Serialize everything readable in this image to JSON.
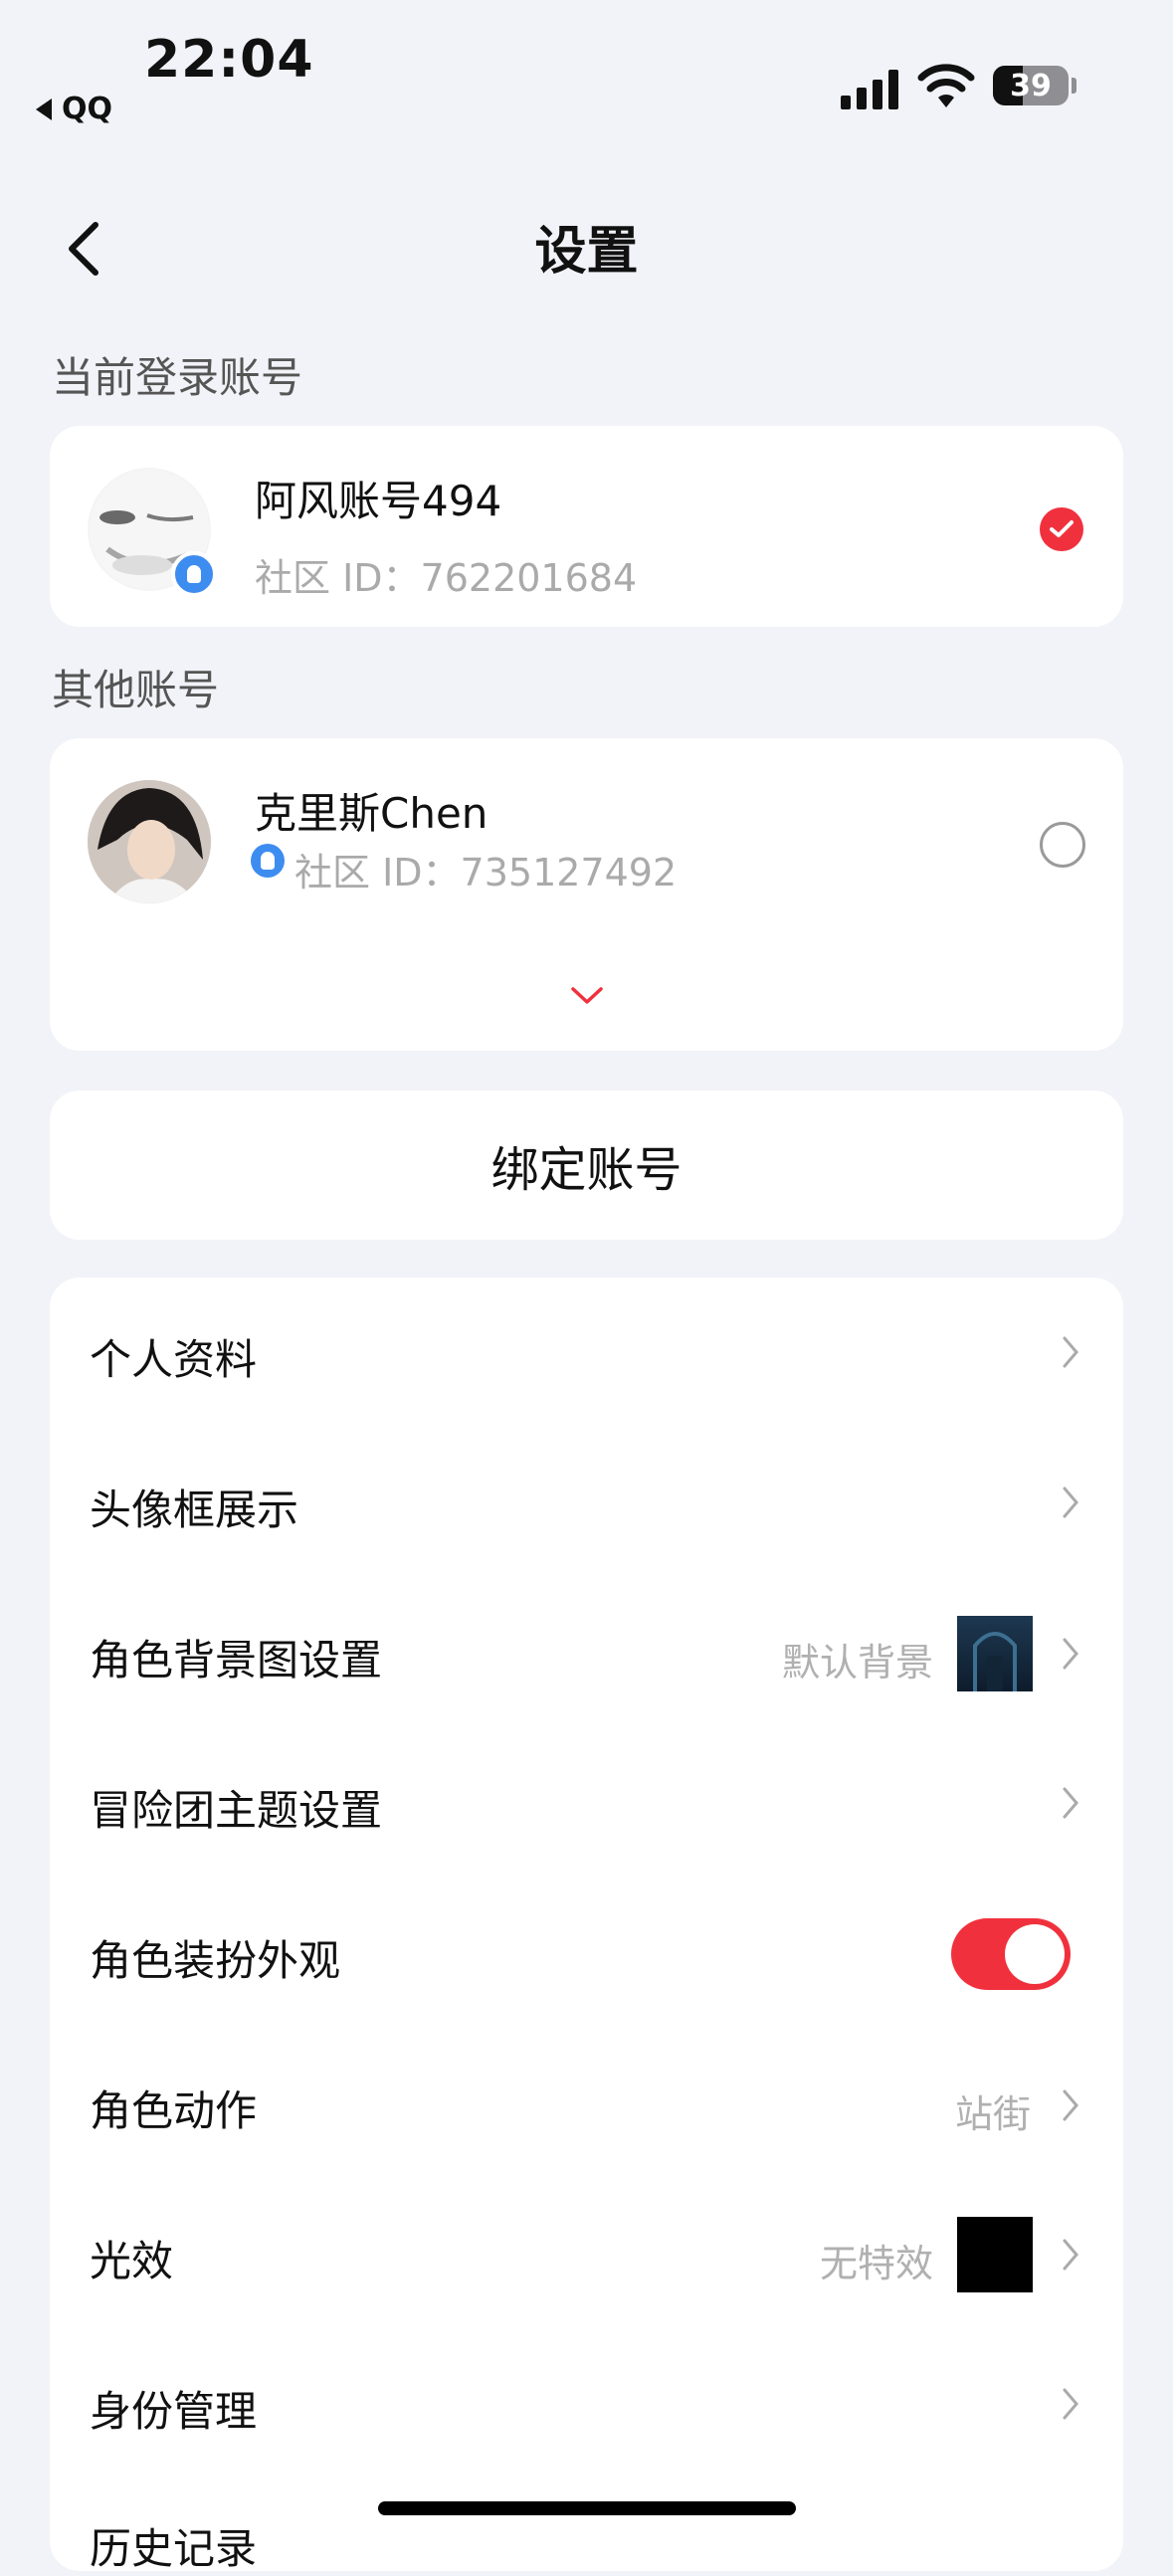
{
  "status_bar": {
    "time": "22:04",
    "back_app": "QQ",
    "battery": "39"
  },
  "nav": {
    "title": "设置"
  },
  "current_section": {
    "label": "当前登录账号"
  },
  "current_account": {
    "name": "阿风账号494",
    "id_text": "社区 ID：762201684",
    "selected": true
  },
  "other_section": {
    "label": "其他账号"
  },
  "other_account": {
    "name": "克里斯Chen",
    "id_text": "社区 ID：735127492",
    "selected": false
  },
  "bind": {
    "label": "绑定账号"
  },
  "settings": [
    {
      "label": "个人资料"
    },
    {
      "label": "头像框展示"
    },
    {
      "label": "角色背景图设置",
      "value": "默认背景",
      "thumb": "dark-blue-background"
    },
    {
      "label": "冒险团主题设置"
    },
    {
      "label": "角色装扮外观",
      "toggle": true
    },
    {
      "label": "角色动作",
      "value": "站街"
    },
    {
      "label": "光效",
      "value": "无特效",
      "thumb": "black"
    },
    {
      "label": "身份管理"
    },
    {
      "label": "历史记录"
    }
  ],
  "colors": {
    "accent": "#f0313d",
    "background": "#f2f3f8",
    "qq_blue": "#3d8cf0"
  }
}
